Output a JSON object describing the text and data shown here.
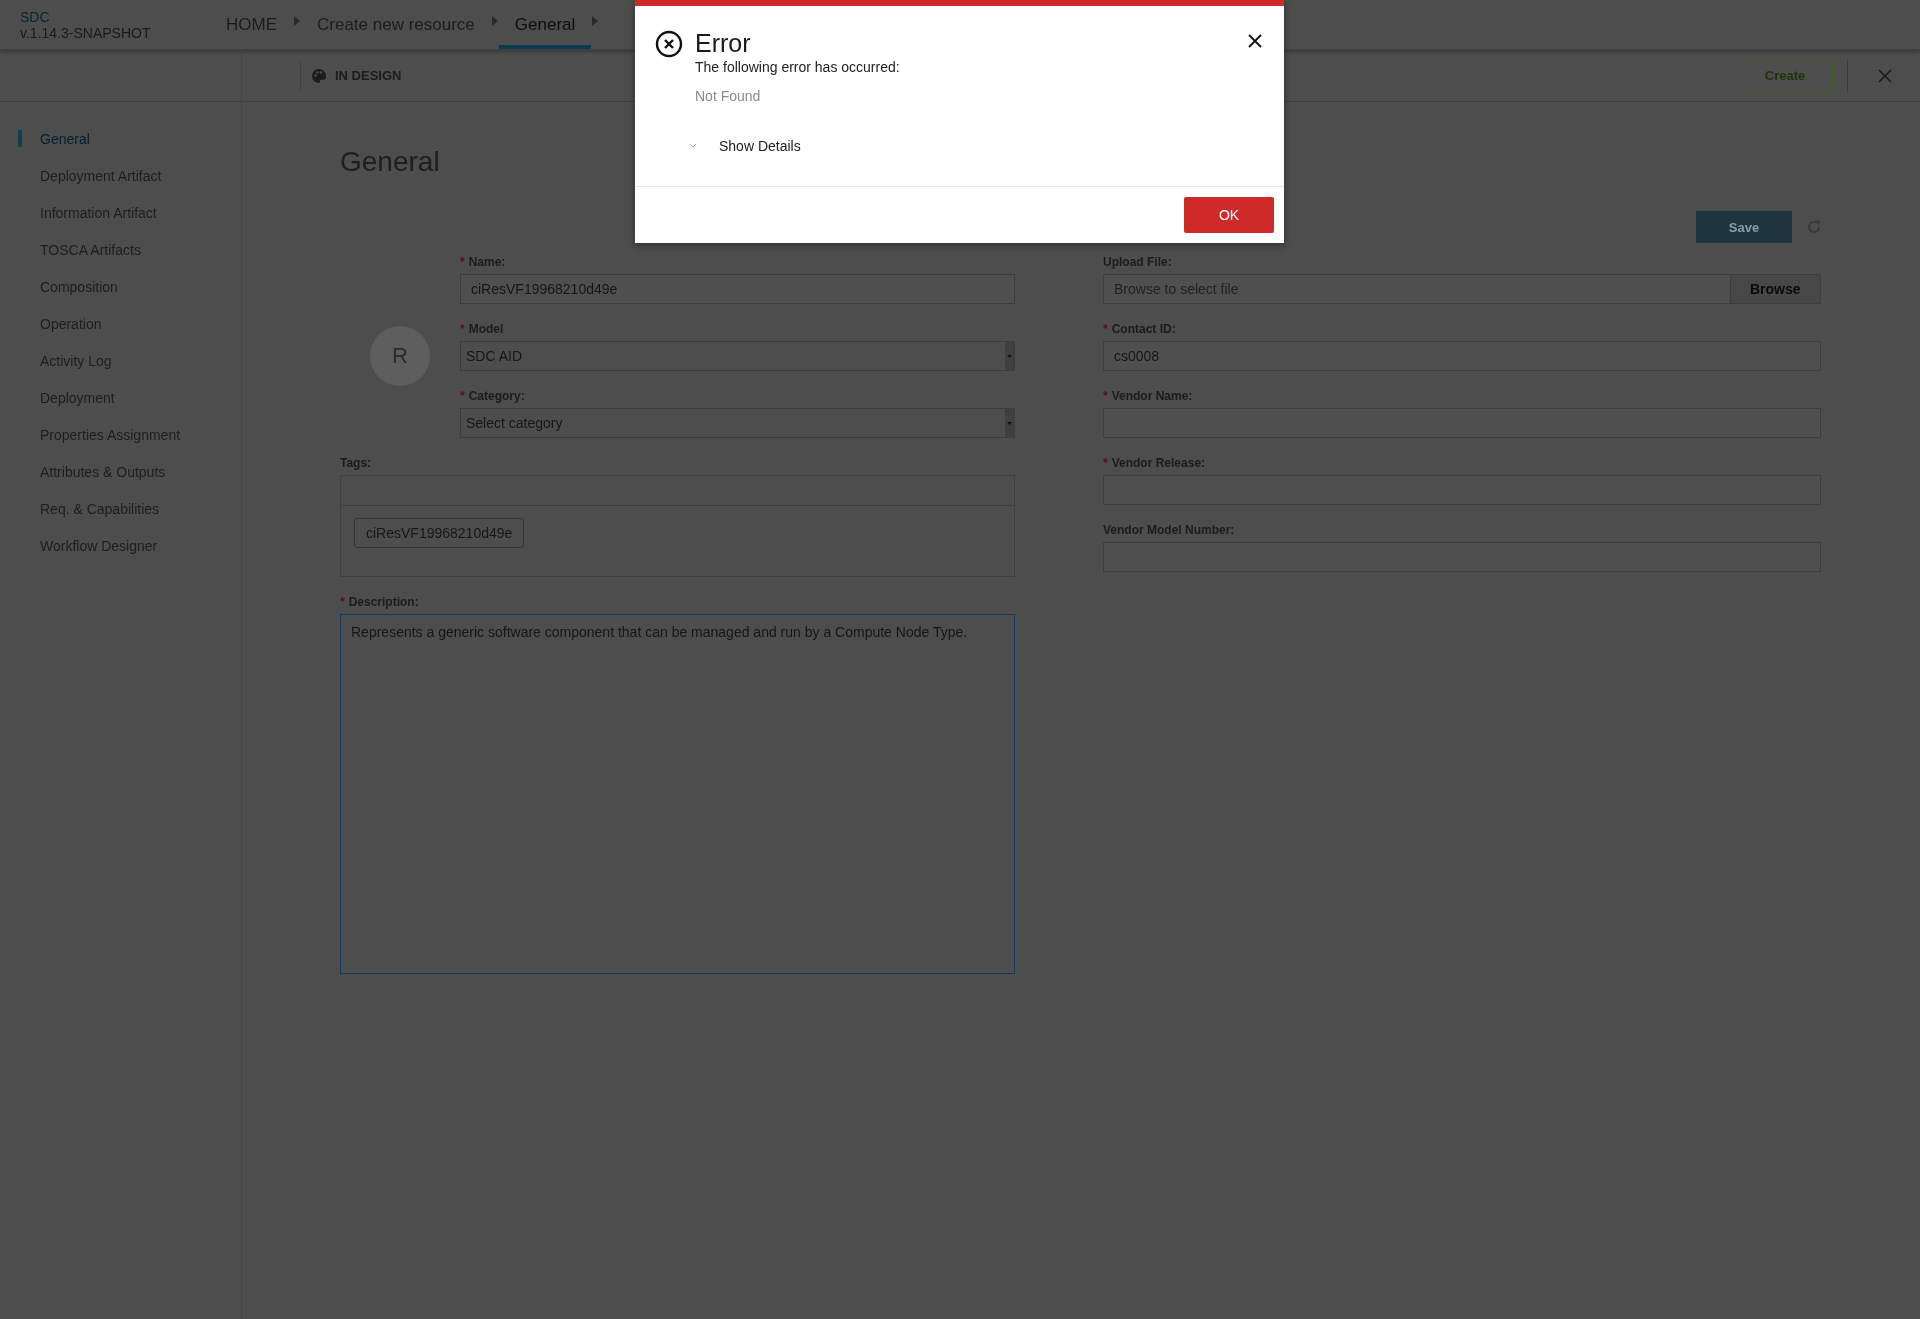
{
  "header": {
    "app_name": "SDC",
    "version": "v.1.14.3-SNAPSHOT",
    "breadcrumbs": [
      {
        "label": "HOME",
        "selected": false
      },
      {
        "label": "Create new resource",
        "selected": false
      },
      {
        "label": "General",
        "selected": true
      }
    ]
  },
  "toolbar": {
    "status": "IN DESIGN",
    "create_button": "Create"
  },
  "sidebar": {
    "items": [
      {
        "label": "General",
        "selected": true
      },
      {
        "label": "Deployment Artifact",
        "selected": false
      },
      {
        "label": "Information Artifact",
        "selected": false
      },
      {
        "label": "TOSCA Artifacts",
        "selected": false
      },
      {
        "label": "Composition",
        "selected": false
      },
      {
        "label": "Operation",
        "selected": false
      },
      {
        "label": "Activity Log",
        "selected": false
      },
      {
        "label": "Deployment",
        "selected": false
      },
      {
        "label": "Properties Assignment",
        "selected": false
      },
      {
        "label": "Attributes & Outputs",
        "selected": false
      },
      {
        "label": "Req. & Capabilities",
        "selected": false
      },
      {
        "label": "Workflow Designer",
        "selected": false
      }
    ]
  },
  "page": {
    "title": "General",
    "save_button": "Save",
    "avatar_letter": "R"
  },
  "left_fields": [
    {
      "kind": "text",
      "marker": "*",
      "label": "Name:",
      "value": "ciResVF19968210d49e"
    },
    {
      "kind": "select",
      "marker": "*",
      "label": "Model",
      "value": "SDC AID"
    },
    {
      "kind": "select",
      "marker": "*",
      "label": "Category:",
      "value": "Select category"
    }
  ],
  "tags": {
    "label": "Tags:",
    "values": [
      "ciResVF19968210d49e"
    ]
  },
  "description": {
    "marker": "*",
    "label": "Description:",
    "value": "Represents a generic software component that can be managed and run by a Compute Node Type."
  },
  "right_fields": [
    {
      "kind": "file",
      "label": "Upload File:",
      "placeholder": "Browse to select file",
      "button": "Browse"
    },
    {
      "kind": "text",
      "marker": "*",
      "label": "Contact ID:",
      "value": "cs0008"
    },
    {
      "kind": "text",
      "marker": "*",
      "label": "Vendor Name:"
    },
    {
      "kind": "text",
      "marker": "*",
      "label": "Vendor Release:"
    },
    {
      "kind": "text",
      "label": "Vendor Model Number:"
    }
  ],
  "dialog": {
    "title": "Error",
    "message": "The following error has occurred:",
    "detail": "Not Found",
    "toggle": "Show Details",
    "expanded": false,
    "ok_button": "OK"
  }
}
